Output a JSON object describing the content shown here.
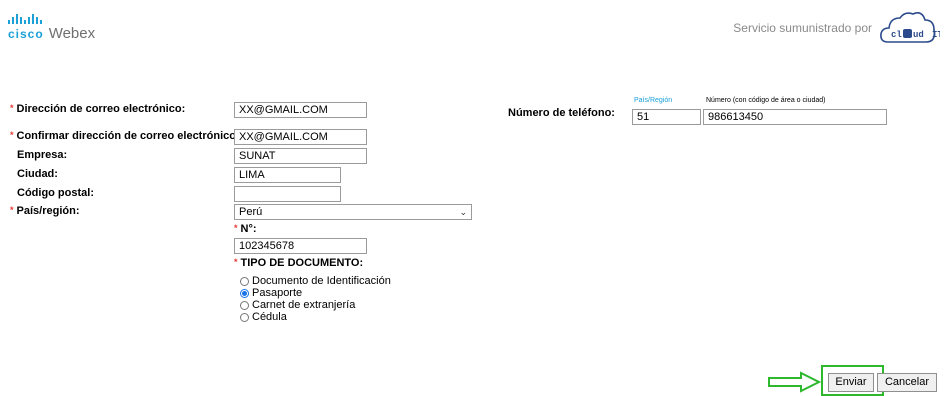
{
  "header": {
    "cisco_text": "cisco",
    "webex_text": "Webex",
    "provided_by": "Servicio sumunistrado por",
    "partner_logo_text": "cl ud IT"
  },
  "form": {
    "email": {
      "label": "Dirección de correo electrónico:",
      "value": "XX@GMAIL.COM"
    },
    "confirm_email": {
      "label": "Confirmar dirección de correo electrónico:",
      "value": "XX@GMAIL.COM"
    },
    "company": {
      "label": "Empresa:",
      "value": "SUNAT"
    },
    "city": {
      "label": "Ciudad:",
      "value": "LIMA"
    },
    "postal_code": {
      "label": "Código postal:",
      "value": ""
    },
    "country": {
      "label": "País/región:",
      "value": "Perú"
    },
    "doc_number": {
      "label": "N°:",
      "value": "102345678"
    },
    "doc_type": {
      "label": "TIPO DE DOCUMENTO:",
      "options": [
        "Documento de Identificación",
        "Pasaporte",
        "Carnet de extranjería",
        "Cédula"
      ],
      "selected": "Pasaporte"
    },
    "phone": {
      "label": "Número de teléfono:",
      "region_label": "País/Región",
      "number_label": "Número (con código de área o ciudad)",
      "region_value": "51",
      "number_value": "986613450"
    },
    "required_marker": "*"
  },
  "actions": {
    "submit": "Enviar",
    "cancel": "Cancelar"
  },
  "colors": {
    "brand": "#1ba0d7",
    "required": "#e53935",
    "highlight": "#2eb82e"
  }
}
